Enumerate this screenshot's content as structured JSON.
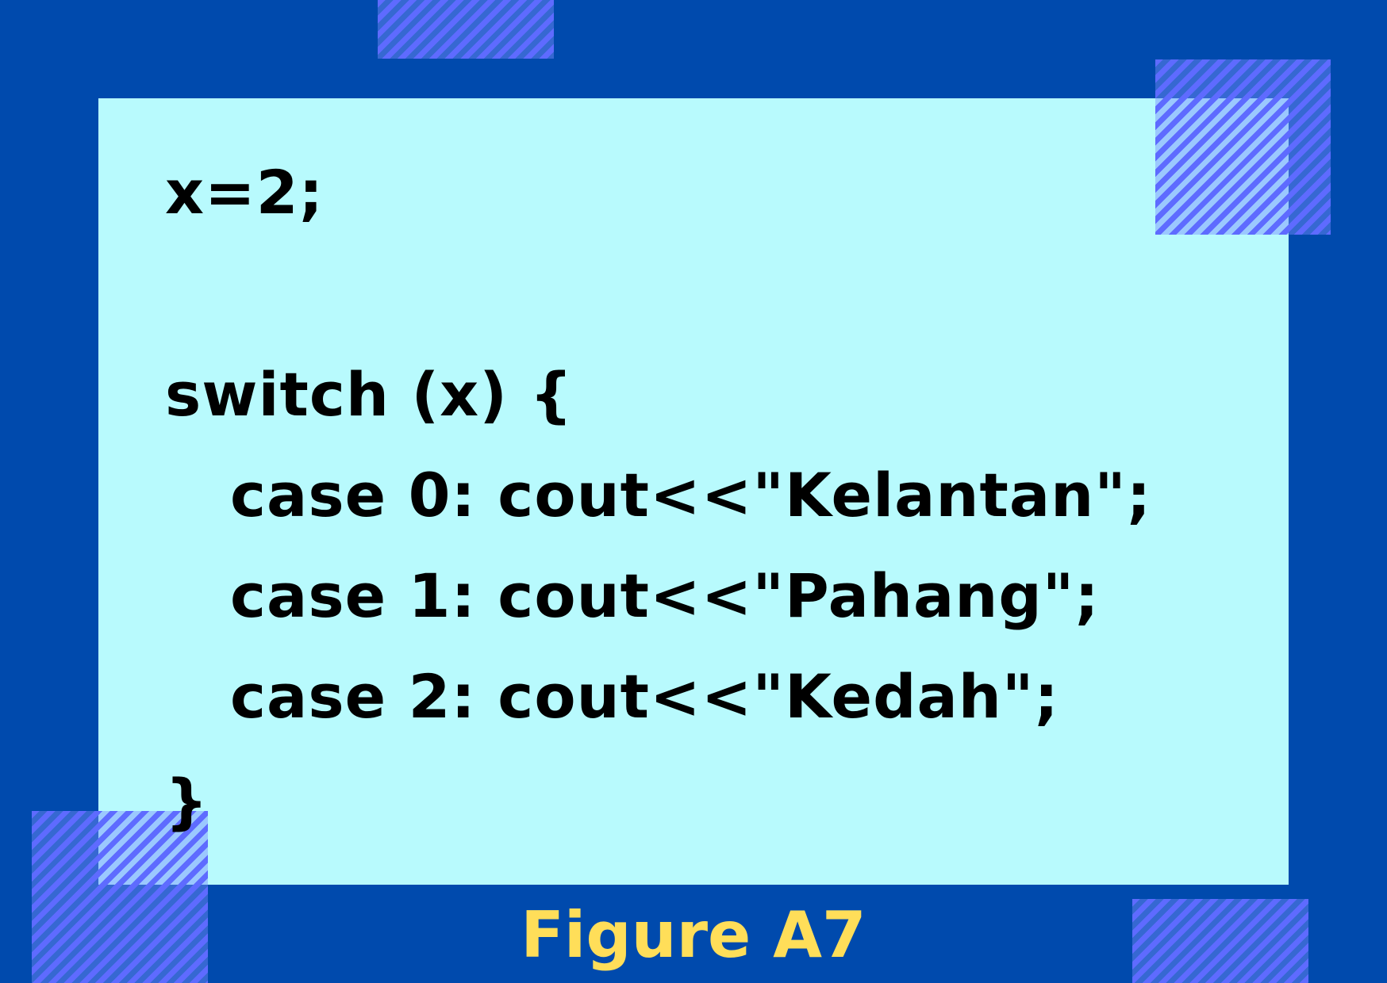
{
  "code_lines": [
    "x=2;",
    "switch (x) {",
    "case 0: cout<<\"Kelantan\";",
    "case 1: cout<<\"Pahang\";",
    "case 2: cout<<\"Kedah\";",
    "}"
  ],
  "caption": "Figure A7",
  "colors": {
    "frame_background": "#004aad",
    "panel_background": "#b8fafd",
    "hatch_stripe": "#5e6bff",
    "code_text": "#000000",
    "caption_text": "#ffde59"
  }
}
